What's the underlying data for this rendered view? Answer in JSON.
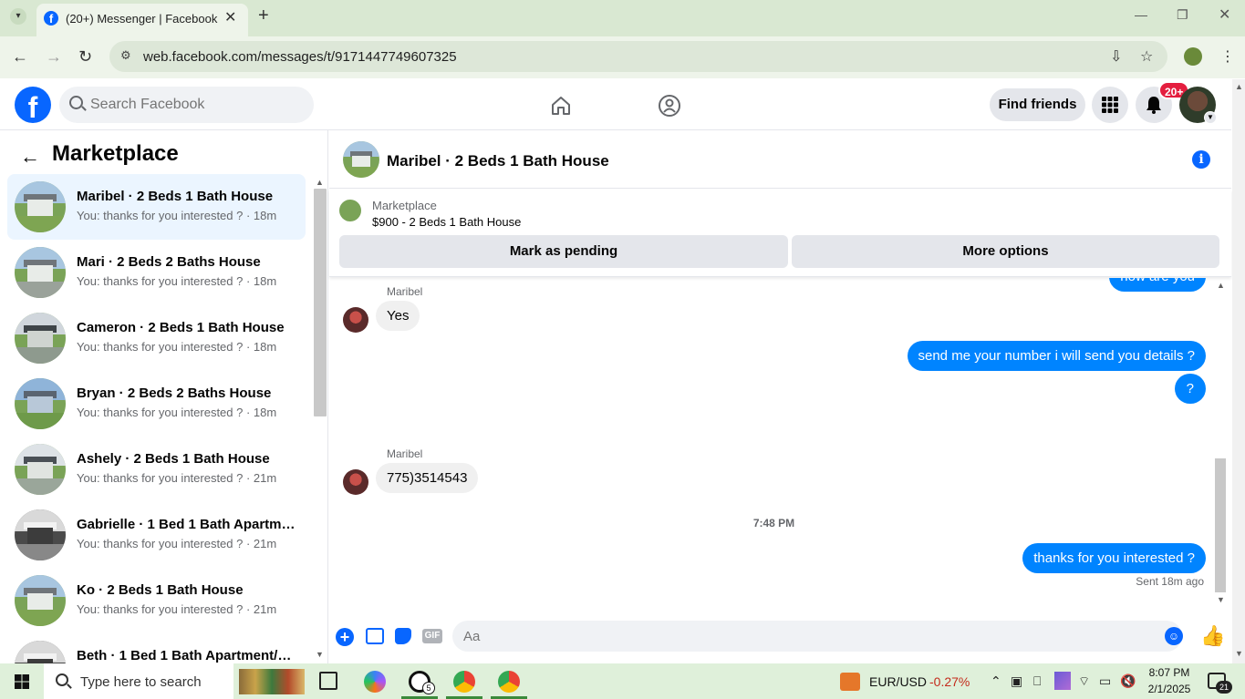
{
  "browser": {
    "tab_title": "(20+) Messenger | Facebook",
    "tab_favicon": "f",
    "url": "web.facebook.com/messages/t/9171447749607325"
  },
  "facebook": {
    "search_placeholder": "Search Facebook",
    "logo_letter": "f",
    "find_friends": "Find friends",
    "notification_badge": "20+"
  },
  "sidebar": {
    "title": "Marketplace",
    "conversations": [
      {
        "name": "Maribel · 2 Beds 1 Bath House",
        "last": "You: thanks for you interested ? · 18m"
      },
      {
        "name": "Mari · 2 Beds 2 Baths House",
        "last": "You: thanks for you interested ? · 18m"
      },
      {
        "name": "Cameron · 2 Beds 1 Bath House",
        "last": "You: thanks for you interested ? · 18m"
      },
      {
        "name": "Bryan · 2 Beds 2 Baths House",
        "last": "You: thanks for you interested ? · 18m"
      },
      {
        "name": "Ashely · 2 Beds 1 Bath House",
        "last": "You: thanks for you interested ? · 21m"
      },
      {
        "name": "Gabrielle · 1 Bed 1 Bath Apartme...",
        "last": "You: thanks for you interested ? · 21m"
      },
      {
        "name": "Ko · 2 Beds 1 Bath House",
        "last": "You: thanks for you interested ? · 21m"
      },
      {
        "name": "Beth · 1 Bed 1 Bath Apartment/c...",
        "last": ""
      }
    ]
  },
  "chat": {
    "title": "Maribel · 2 Beds 1 Bath House",
    "info_icon": "i",
    "marketplace_label": "Marketplace",
    "listing": "$900 - 2 Beds 1 Bath House",
    "mark_pending": "Mark as pending",
    "more_options": "More options",
    "partial_top": "how are you",
    "messages": {
      "m1_sender": "Maribel",
      "m1_text": "Yes",
      "m2_text": "send me your number i will send you details ?",
      "m3_text": "?",
      "m4_sender": "Maribel",
      "m4_text": "775)3514543",
      "time_divider": "7:48 PM",
      "m5_text": "thanks for you interested ?",
      "status": "Sent 18m ago"
    },
    "composer_placeholder": "Aa",
    "gif_label": "GIF",
    "plus_label": "+"
  },
  "taskbar": {
    "search_text": "Type here to search",
    "ticker": "EUR/USD",
    "ticker_change": "-0.27%",
    "whatsapp_badge": "5",
    "time": "8:07 PM",
    "date": "2/1/2025",
    "notification_count": "21"
  },
  "colors": {
    "fb_blue": "#0866ff",
    "messenger_blue": "#0084ff",
    "active_row": "#ebf5ff",
    "badge_red": "#e41e3f",
    "negative": "#c42b1c"
  }
}
